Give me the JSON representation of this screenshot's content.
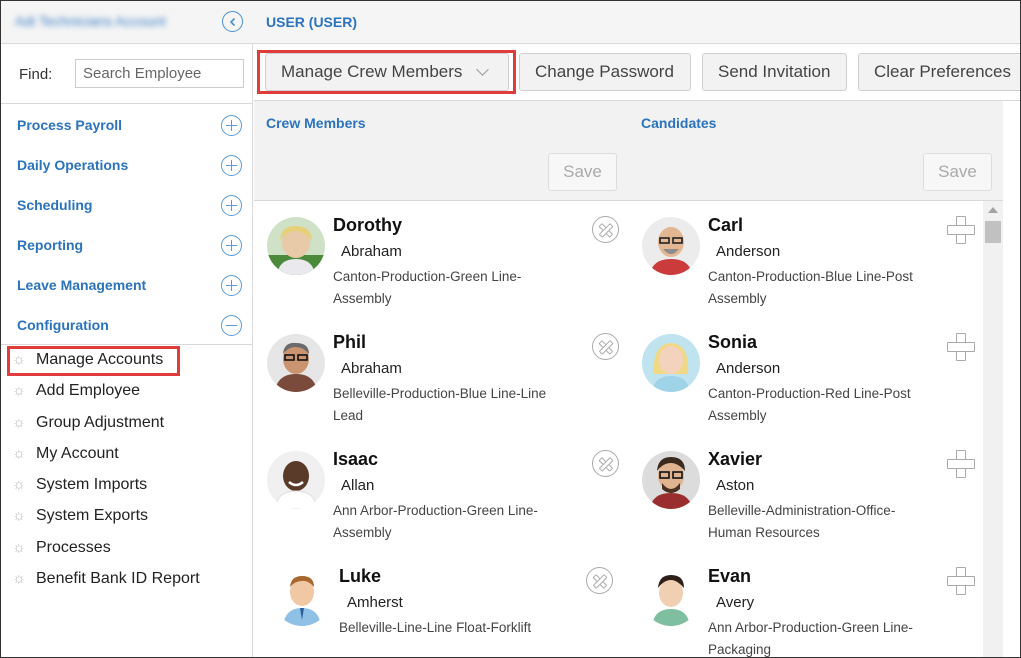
{
  "header": {
    "account_name": "Adi Technicians Account",
    "page_title": "USER (USER)"
  },
  "sidebar": {
    "find_label": "Find:",
    "search_placeholder": "Search Employee",
    "menu": [
      {
        "label": "Process Payroll",
        "state": "collapsed"
      },
      {
        "label": "Daily Operations",
        "state": "collapsed"
      },
      {
        "label": "Scheduling",
        "state": "collapsed"
      },
      {
        "label": "Reporting",
        "state": "collapsed"
      },
      {
        "label": "Leave Management",
        "state": "collapsed"
      },
      {
        "label": "Configuration",
        "state": "expanded"
      }
    ],
    "submenu": [
      {
        "label": "Manage Accounts",
        "active": true
      },
      {
        "label": "Add Employee"
      },
      {
        "label": "Group Adjustment"
      },
      {
        "label": "My Account"
      },
      {
        "label": "System Imports"
      },
      {
        "label": "System Exports"
      },
      {
        "label": "Processes"
      },
      {
        "label": "Benefit Bank ID Report"
      }
    ]
  },
  "toolbar": {
    "manage_label": "Manage Crew Members",
    "password_label": "Change Password",
    "invite_label": "Send Invitation",
    "clear_label": "Clear Preferences"
  },
  "columns": {
    "crew_label": "Crew Members",
    "candidates_label": "Candidates",
    "save_label": "Save"
  },
  "crew_members": [
    {
      "first": "Dorothy",
      "last": "Abraham",
      "dept": "Canton-Production-Green Line-Assembly"
    },
    {
      "first": "Phil",
      "last": "Abraham",
      "dept": "Belleville-Production-Blue Line-Line Lead"
    },
    {
      "first": "Isaac",
      "last": "Allan",
      "dept": "Ann Arbor-Production-Green Line-Assembly"
    },
    {
      "first": "Luke",
      "last": "Amherst",
      "dept": "Belleville-Line-Line Float-Forklift"
    }
  ],
  "candidates": [
    {
      "first": "Carl",
      "last": "Anderson",
      "dept": "Canton-Production-Blue Line-Post Assembly"
    },
    {
      "first": "Sonia",
      "last": "Anderson",
      "dept": "Canton-Production-Red Line-Post Assembly"
    },
    {
      "first": "Xavier",
      "last": "Aston",
      "dept": "Belleville-Administration-Office-Human Resources"
    },
    {
      "first": "Evan",
      "last": "Avery",
      "dept": "Ann Arbor-Production-Green Line-Packaging"
    }
  ],
  "colors": {
    "accent": "#2b73bd",
    "highlight": "#e03c3c"
  }
}
